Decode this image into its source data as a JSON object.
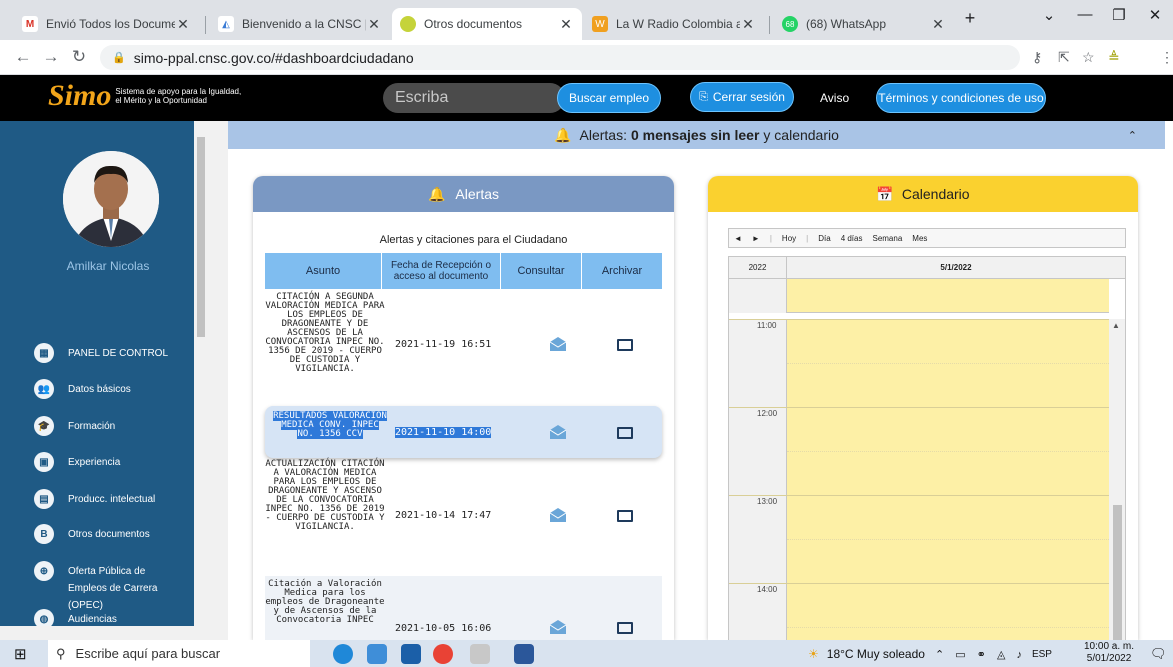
{
  "browser": {
    "tabs": [
      {
        "title": "Envió Todos los Documentos",
        "favicon": "gmail-icon"
      },
      {
        "title": "Bienvenido a la CNSC | CNSC",
        "favicon": "cnsc-icon"
      },
      {
        "title": "Otros documentos",
        "favicon": "simo-icon",
        "active": true
      },
      {
        "title": "La W Radio Colombia audio",
        "favicon": "wradio-icon"
      },
      {
        "title": "(68) WhatsApp",
        "favicon": "whatsapp-icon"
      }
    ],
    "url": "simo-ppal.cnsc.gov.co/#dashboardciudadano"
  },
  "header": {
    "logo_text": "Simo",
    "logo_tagline_1": "Sistema de apoyo para la Igualdad,",
    "logo_tagline_2": "el Mérito y la Oportunidad",
    "search_placeholder": "Escriba",
    "buscar_empleo": "Buscar empleo",
    "cerrar_sesion": "Cerrar sesión",
    "aviso": "Aviso",
    "terminos": "Términos y condiciones de uso"
  },
  "sidebar": {
    "user_name": "Amilkar Nicolas",
    "items": [
      {
        "label": "PANEL DE CONTROL",
        "icon": "grid-icon"
      },
      {
        "label": "Datos básicos",
        "icon": "people-icon"
      },
      {
        "label": "Formación",
        "icon": "graduation-icon"
      },
      {
        "label": "Experiencia",
        "icon": "briefcase-icon"
      },
      {
        "label": "Producc. intelectual",
        "icon": "book-icon"
      },
      {
        "label": "Otros documentos",
        "icon": "document-icon"
      },
      {
        "label": "Oferta Pública de",
        "label2": "Empleos de Carrera (OPEC)",
        "icon": "globe-icon"
      },
      {
        "label": "Audiencias",
        "icon": "audience-icon"
      }
    ]
  },
  "alert_bar": {
    "prefix": "Alertas:",
    "count_text": "0 mensajes sin leer",
    "suffix": "y calendario"
  },
  "alerts": {
    "title": "Alertas",
    "subtitle": "Alertas y citaciones para el Ciudadano",
    "columns": [
      "Asunto",
      "Fecha de Recepción o acceso al documento",
      "Consultar",
      "Archivar"
    ],
    "rows": [
      {
        "subject": "CITACIÓN A SEGUNDA VALORACIÓN MEDICA PARA LOS EMPLEOS DE DRAGONEANTE Y DE ASCENSOS DE LA CONVOCATORIA INPEC NO. 1356 DE 2019 - CUERPO DE CUSTODIA Y VIGILANCIA.",
        "date": "2021-11-19 16:51"
      },
      {
        "subject": "RESULTADOS VALORACION MEDICA CONV. INPEC NO. 1356 CCV",
        "date": "2021-11-10 14:00",
        "selected": true
      },
      {
        "subject": "ACTUALIZACIÓN CITACIÓN A VALORACIÓN MEDICA PARA LOS EMPLEOS DE DRAGONEANTE Y ASCENSO DE LA CONVOCATORIA INPEC NO. 1356 DE 2019 - CUERPO DE CUSTODIA Y VIGILANCIA.",
        "date": "2021-10-14 17:47"
      },
      {
        "subject": "Citación a Valoración Medica para los empleos de Dragoneante y de Ascensos de la Convocatoria INPEC",
        "date": "2021-10-05 16:06"
      }
    ]
  },
  "calendar": {
    "title": "Calendario",
    "toolbar": [
      "◄",
      "►",
      "Hoy",
      "Día",
      "4 días",
      "Semana",
      "Mes"
    ],
    "year": "2022",
    "date": "5/1/2022",
    "hours": [
      "11:00",
      "12:00",
      "13:00",
      "14:00"
    ]
  },
  "taskbar": {
    "search_placeholder": "Escribe aquí para buscar",
    "weather": "18°C  Muy soleado",
    "lang": "ESP",
    "time": "10:00 a. m.",
    "date": "5/01/2022"
  }
}
